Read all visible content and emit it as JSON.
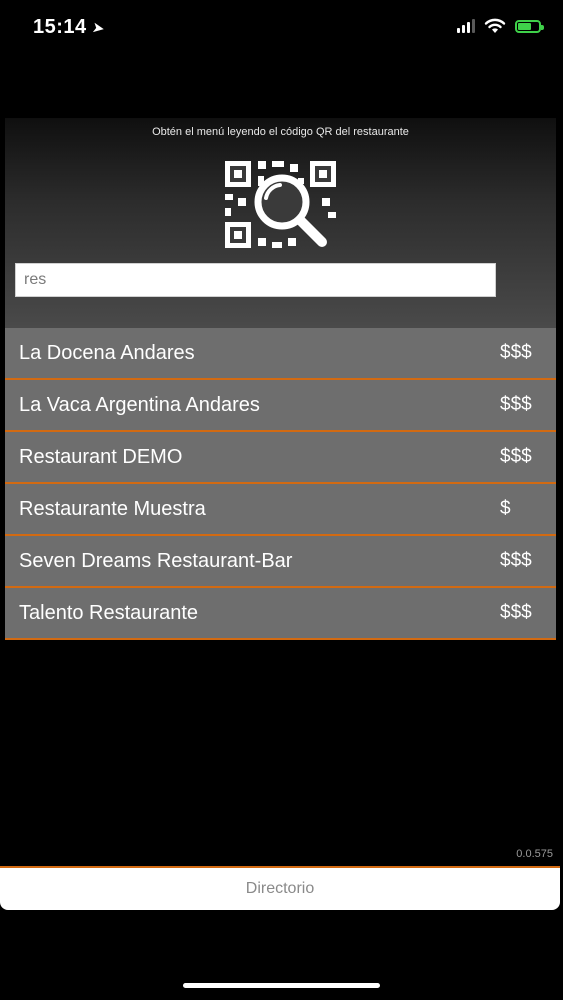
{
  "status_bar": {
    "time": "15:14",
    "location_icon": "location-arrow-icon",
    "battery_color": "#3fd14a"
  },
  "header": {
    "caption": "Obtén el menú leyendo el código QR del restaurante",
    "qr_icon": "qr-scan-icon"
  },
  "search": {
    "value": "res"
  },
  "results": [
    {
      "name": "La Docena Andares",
      "price": "$$$"
    },
    {
      "name": "La Vaca Argentina Andares",
      "price": "$$$"
    },
    {
      "name": "Restaurant DEMO",
      "price": "$$$"
    },
    {
      "name": "Restaurante Muestra",
      "price": "$"
    },
    {
      "name": "Seven Dreams Restaurant-Bar",
      "price": "$$$"
    },
    {
      "name": "Talento Restaurante",
      "price": "$$$"
    }
  ],
  "version": "0.0.575",
  "tab_bar": {
    "label": "Directorio"
  },
  "colors": {
    "accent": "#d26a12",
    "row_bg": "#6e6e6e"
  }
}
